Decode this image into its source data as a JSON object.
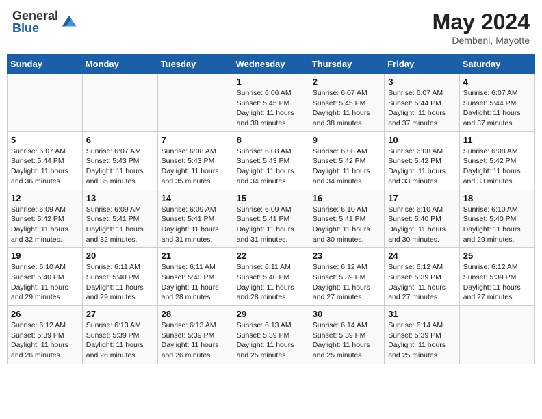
{
  "header": {
    "logo_general": "General",
    "logo_blue": "Blue",
    "month_year": "May 2024",
    "location": "Dembeni, Mayotte"
  },
  "days_of_week": [
    "Sunday",
    "Monday",
    "Tuesday",
    "Wednesday",
    "Thursday",
    "Friday",
    "Saturday"
  ],
  "weeks": [
    [
      {
        "num": "",
        "info": ""
      },
      {
        "num": "",
        "info": ""
      },
      {
        "num": "",
        "info": ""
      },
      {
        "num": "1",
        "info": "Sunrise: 6:06 AM\nSunset: 5:45 PM\nDaylight: 11 hours and 38 minutes."
      },
      {
        "num": "2",
        "info": "Sunrise: 6:07 AM\nSunset: 5:45 PM\nDaylight: 11 hours and 38 minutes."
      },
      {
        "num": "3",
        "info": "Sunrise: 6:07 AM\nSunset: 5:44 PM\nDaylight: 11 hours and 37 minutes."
      },
      {
        "num": "4",
        "info": "Sunrise: 6:07 AM\nSunset: 5:44 PM\nDaylight: 11 hours and 37 minutes."
      }
    ],
    [
      {
        "num": "5",
        "info": "Sunrise: 6:07 AM\nSunset: 5:44 PM\nDaylight: 11 hours and 36 minutes."
      },
      {
        "num": "6",
        "info": "Sunrise: 6:07 AM\nSunset: 5:43 PM\nDaylight: 11 hours and 35 minutes."
      },
      {
        "num": "7",
        "info": "Sunrise: 6:08 AM\nSunset: 5:43 PM\nDaylight: 11 hours and 35 minutes."
      },
      {
        "num": "8",
        "info": "Sunrise: 6:08 AM\nSunset: 5:43 PM\nDaylight: 11 hours and 34 minutes."
      },
      {
        "num": "9",
        "info": "Sunrise: 6:08 AM\nSunset: 5:42 PM\nDaylight: 11 hours and 34 minutes."
      },
      {
        "num": "10",
        "info": "Sunrise: 6:08 AM\nSunset: 5:42 PM\nDaylight: 11 hours and 33 minutes."
      },
      {
        "num": "11",
        "info": "Sunrise: 6:08 AM\nSunset: 5:42 PM\nDaylight: 11 hours and 33 minutes."
      }
    ],
    [
      {
        "num": "12",
        "info": "Sunrise: 6:09 AM\nSunset: 5:42 PM\nDaylight: 11 hours and 32 minutes."
      },
      {
        "num": "13",
        "info": "Sunrise: 6:09 AM\nSunset: 5:41 PM\nDaylight: 11 hours and 32 minutes."
      },
      {
        "num": "14",
        "info": "Sunrise: 6:09 AM\nSunset: 5:41 PM\nDaylight: 11 hours and 31 minutes."
      },
      {
        "num": "15",
        "info": "Sunrise: 6:09 AM\nSunset: 5:41 PM\nDaylight: 11 hours and 31 minutes."
      },
      {
        "num": "16",
        "info": "Sunrise: 6:10 AM\nSunset: 5:41 PM\nDaylight: 11 hours and 30 minutes."
      },
      {
        "num": "17",
        "info": "Sunrise: 6:10 AM\nSunset: 5:40 PM\nDaylight: 11 hours and 30 minutes."
      },
      {
        "num": "18",
        "info": "Sunrise: 6:10 AM\nSunset: 5:40 PM\nDaylight: 11 hours and 29 minutes."
      }
    ],
    [
      {
        "num": "19",
        "info": "Sunrise: 6:10 AM\nSunset: 5:40 PM\nDaylight: 11 hours and 29 minutes."
      },
      {
        "num": "20",
        "info": "Sunrise: 6:11 AM\nSunset: 5:40 PM\nDaylight: 11 hours and 29 minutes."
      },
      {
        "num": "21",
        "info": "Sunrise: 6:11 AM\nSunset: 5:40 PM\nDaylight: 11 hours and 28 minutes."
      },
      {
        "num": "22",
        "info": "Sunrise: 6:11 AM\nSunset: 5:40 PM\nDaylight: 11 hours and 28 minutes."
      },
      {
        "num": "23",
        "info": "Sunrise: 6:12 AM\nSunset: 5:39 PM\nDaylight: 11 hours and 27 minutes."
      },
      {
        "num": "24",
        "info": "Sunrise: 6:12 AM\nSunset: 5:39 PM\nDaylight: 11 hours and 27 minutes."
      },
      {
        "num": "25",
        "info": "Sunrise: 6:12 AM\nSunset: 5:39 PM\nDaylight: 11 hours and 27 minutes."
      }
    ],
    [
      {
        "num": "26",
        "info": "Sunrise: 6:12 AM\nSunset: 5:39 PM\nDaylight: 11 hours and 26 minutes."
      },
      {
        "num": "27",
        "info": "Sunrise: 6:13 AM\nSunset: 5:39 PM\nDaylight: 11 hours and 26 minutes."
      },
      {
        "num": "28",
        "info": "Sunrise: 6:13 AM\nSunset: 5:39 PM\nDaylight: 11 hours and 26 minutes."
      },
      {
        "num": "29",
        "info": "Sunrise: 6:13 AM\nSunset: 5:39 PM\nDaylight: 11 hours and 25 minutes."
      },
      {
        "num": "30",
        "info": "Sunrise: 6:14 AM\nSunset: 5:39 PM\nDaylight: 11 hours and 25 minutes."
      },
      {
        "num": "31",
        "info": "Sunrise: 6:14 AM\nSunset: 5:39 PM\nDaylight: 11 hours and 25 minutes."
      },
      {
        "num": "",
        "info": ""
      }
    ]
  ]
}
